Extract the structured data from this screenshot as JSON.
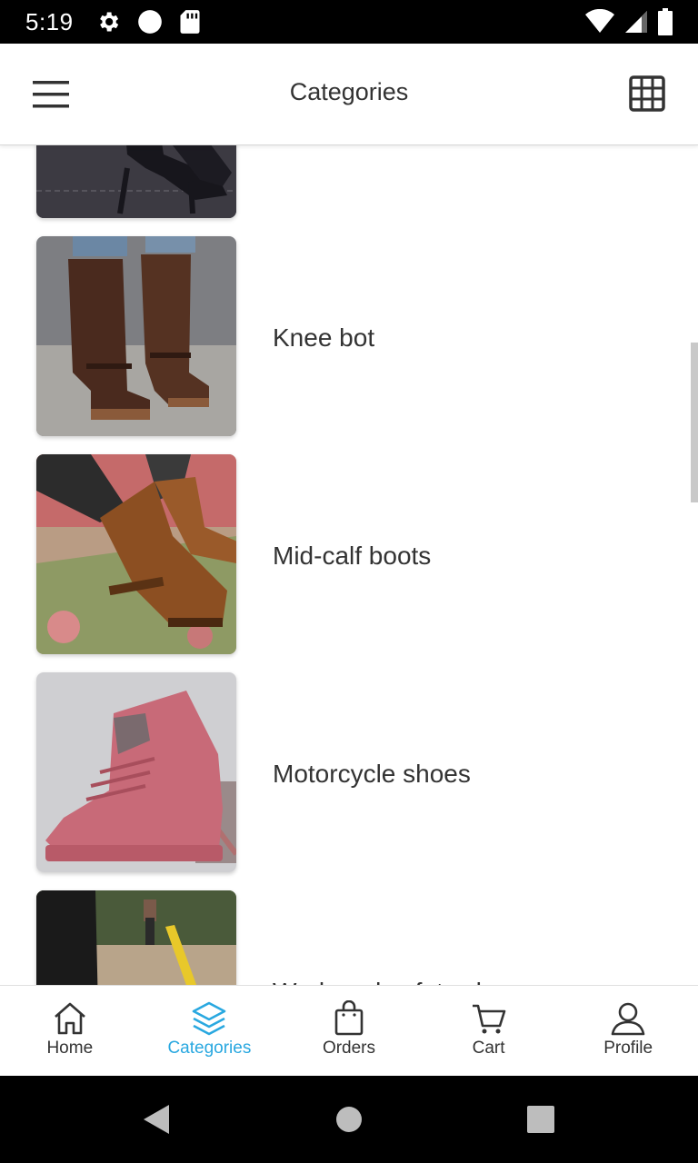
{
  "status_bar": {
    "time": "5:19",
    "left_icons": [
      "settings-icon",
      "circle-icon",
      "sd-card-icon"
    ],
    "right_icons": [
      "wifi-icon",
      "signal-icon",
      "battery-icon"
    ]
  },
  "app_bar": {
    "title": "Categories",
    "menu_icon": "hamburger-menu-icon",
    "view_toggle_icon": "grid-view-icon"
  },
  "categories": [
    {
      "label": "",
      "image": "black-heeled-boots"
    },
    {
      "label": "Knee bot",
      "image": "brown-knee-boots"
    },
    {
      "label": "Mid-calf boots",
      "image": "brown-mid-calf-boots"
    },
    {
      "label": "Motorcycle shoes",
      "image": "pink-motorcycle-shoes"
    },
    {
      "label": "Work and safety shoes",
      "image": "work-safety-shoes"
    }
  ],
  "bottom_nav": {
    "items": [
      {
        "label": "Home",
        "icon": "home-icon",
        "active": false
      },
      {
        "label": "Categories",
        "icon": "layers-icon",
        "active": true
      },
      {
        "label": "Orders",
        "icon": "shopping-bag-icon",
        "active": false
      },
      {
        "label": "Cart",
        "icon": "cart-icon",
        "active": false
      },
      {
        "label": "Profile",
        "icon": "user-icon",
        "active": false
      }
    ],
    "active_color": "#29a8e0",
    "inactive_color": "#333333"
  },
  "system_nav": {
    "buttons": [
      "back-icon",
      "home-circle-icon",
      "recents-square-icon"
    ]
  }
}
